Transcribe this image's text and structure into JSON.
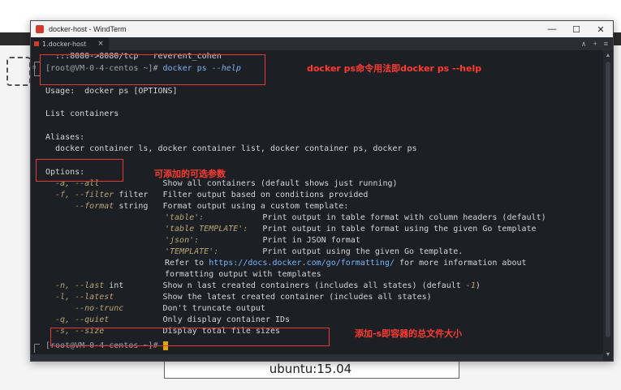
{
  "background": {
    "bottom_label": "ubuntu:15.04"
  },
  "window": {
    "title": "docker-host - WindTerm",
    "controls": [
      "—",
      "☐",
      "✕"
    ],
    "tab_label": "1.docker-host",
    "tab_close": "×",
    "tab_tools": [
      "∧",
      "+",
      "≡"
    ]
  },
  "terminal": {
    "line_prev": "  :::8080->8080/tcp   reverent_cohen",
    "prompt": "[root@VM-0-4-centos ~]# ",
    "cmd_main": "docker ps ",
    "cmd_flag": "--help",
    "usage": "Usage:  docker ps [OPTIONS]",
    "desc": "List containers",
    "aliases_title": "Aliases:",
    "aliases": "  docker container ls, docker container list, docker container ps, docker ps",
    "options_title": "Options:",
    "options": [
      {
        "flag": "  -a, --all",
        "arg": "",
        "pad": "             ",
        "desc": "Show all containers (default shows just running)"
      },
      {
        "flag": "  -f, --filter",
        "arg": " filter",
        "pad": "   ",
        "desc": "Filter output based on conditions provided"
      },
      {
        "flag": "      --format",
        "arg": " string",
        "pad": "   ",
        "desc": "Format output using a custom template:"
      }
    ],
    "format_table": [
      {
        "k": "'table':",
        "pad": "            ",
        "v": "Print output in table format with column headers (default)"
      },
      {
        "k": "'table TEMPLATE':",
        "pad": "   ",
        "v": "Print output in table format using the given Go template"
      },
      {
        "k": "'json':",
        "pad": "             ",
        "v": "Print in JSON format"
      },
      {
        "k": "'TEMPLATE':",
        "pad": "         ",
        "v": "Print output using the given Go template."
      }
    ],
    "refer_pre": "Refer to ",
    "refer_url": "https://docs.docker.com/go/formatting/",
    "refer_post": " for more information about",
    "refer_line2": "formatting output with templates",
    "options2": [
      {
        "flag": "  -n, --last",
        "arg": " int",
        "pad": "        ",
        "desc": "Show n last created containers (includes all states) (default ",
        "tail": "-1",
        "tail_after": ")"
      },
      {
        "flag": "  -l, --latest",
        "arg": "",
        "pad": "          ",
        "desc": "Show the latest created container (includes all states)",
        "tail": "",
        "tail_after": ""
      },
      {
        "flag": "      --no-trunc",
        "arg": "",
        "pad": "        ",
        "desc": "Don't truncate output",
        "tail": "",
        "tail_after": ""
      },
      {
        "flag": "  -q, --quiet",
        "arg": "",
        "pad": "           ",
        "desc": "Only display container IDs",
        "tail": "",
        "tail_after": ""
      },
      {
        "flag": "  -s, --size",
        "arg": "",
        "pad": "            ",
        "desc": "Display total file sizes",
        "tail": "",
        "tail_after": ""
      }
    ],
    "final_prompt": "[root@VM-0-4-centos ~]# "
  },
  "annotations": {
    "note1": "docker ps命令用法即docker ps --help",
    "note2": "可添加的可选参数",
    "note3": "添加-s即容器的总文件大小"
  },
  "colors": {
    "terminal_bg": "#1c1f24",
    "annotation_red": "#ff3b30",
    "cursor": "#e0a800"
  }
}
